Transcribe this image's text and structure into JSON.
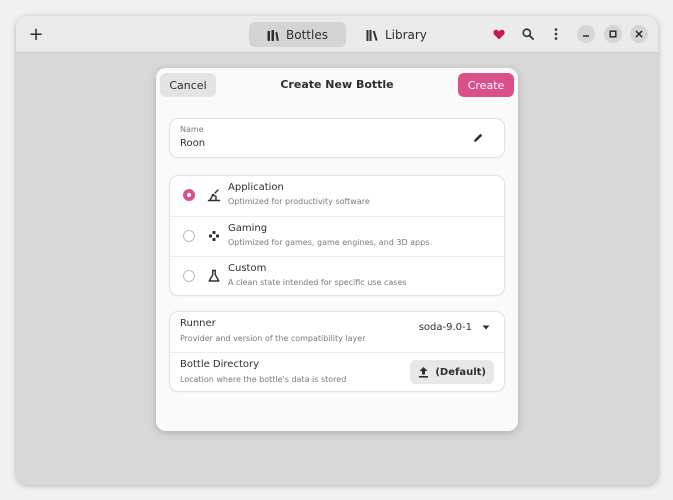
{
  "headerbar": {
    "add_label": "+",
    "tabs": [
      {
        "label": "Bottles",
        "icon": "bottles-icon",
        "active": true
      },
      {
        "label": "Library",
        "icon": "library-icon",
        "active": false
      }
    ],
    "heart_color": "#c2185b"
  },
  "dialog": {
    "title": "Create New Bottle",
    "cancel_label": "Cancel",
    "create_label": "Create",
    "accent_color": "#d9508a",
    "name": {
      "label": "Name",
      "value": "Roon"
    },
    "environments": [
      {
        "title": "Application",
        "subtitle": "Optimized for productivity software",
        "icon": "application-icon",
        "selected": true
      },
      {
        "title": "Gaming",
        "subtitle": "Optimized for games, game engines, and 3D apps",
        "icon": "gamepad-icon",
        "selected": false
      },
      {
        "title": "Custom",
        "subtitle": "A clean state intended for specific use cases",
        "icon": "flask-icon",
        "selected": false
      }
    ],
    "runner": {
      "title": "Runner",
      "subtitle": "Provider and version of the compatibility layer",
      "value": "soda-9.0-1"
    },
    "directory": {
      "title": "Bottle Directory",
      "subtitle": "Location where the bottle's data is stored",
      "button_label": "(Default)"
    }
  }
}
